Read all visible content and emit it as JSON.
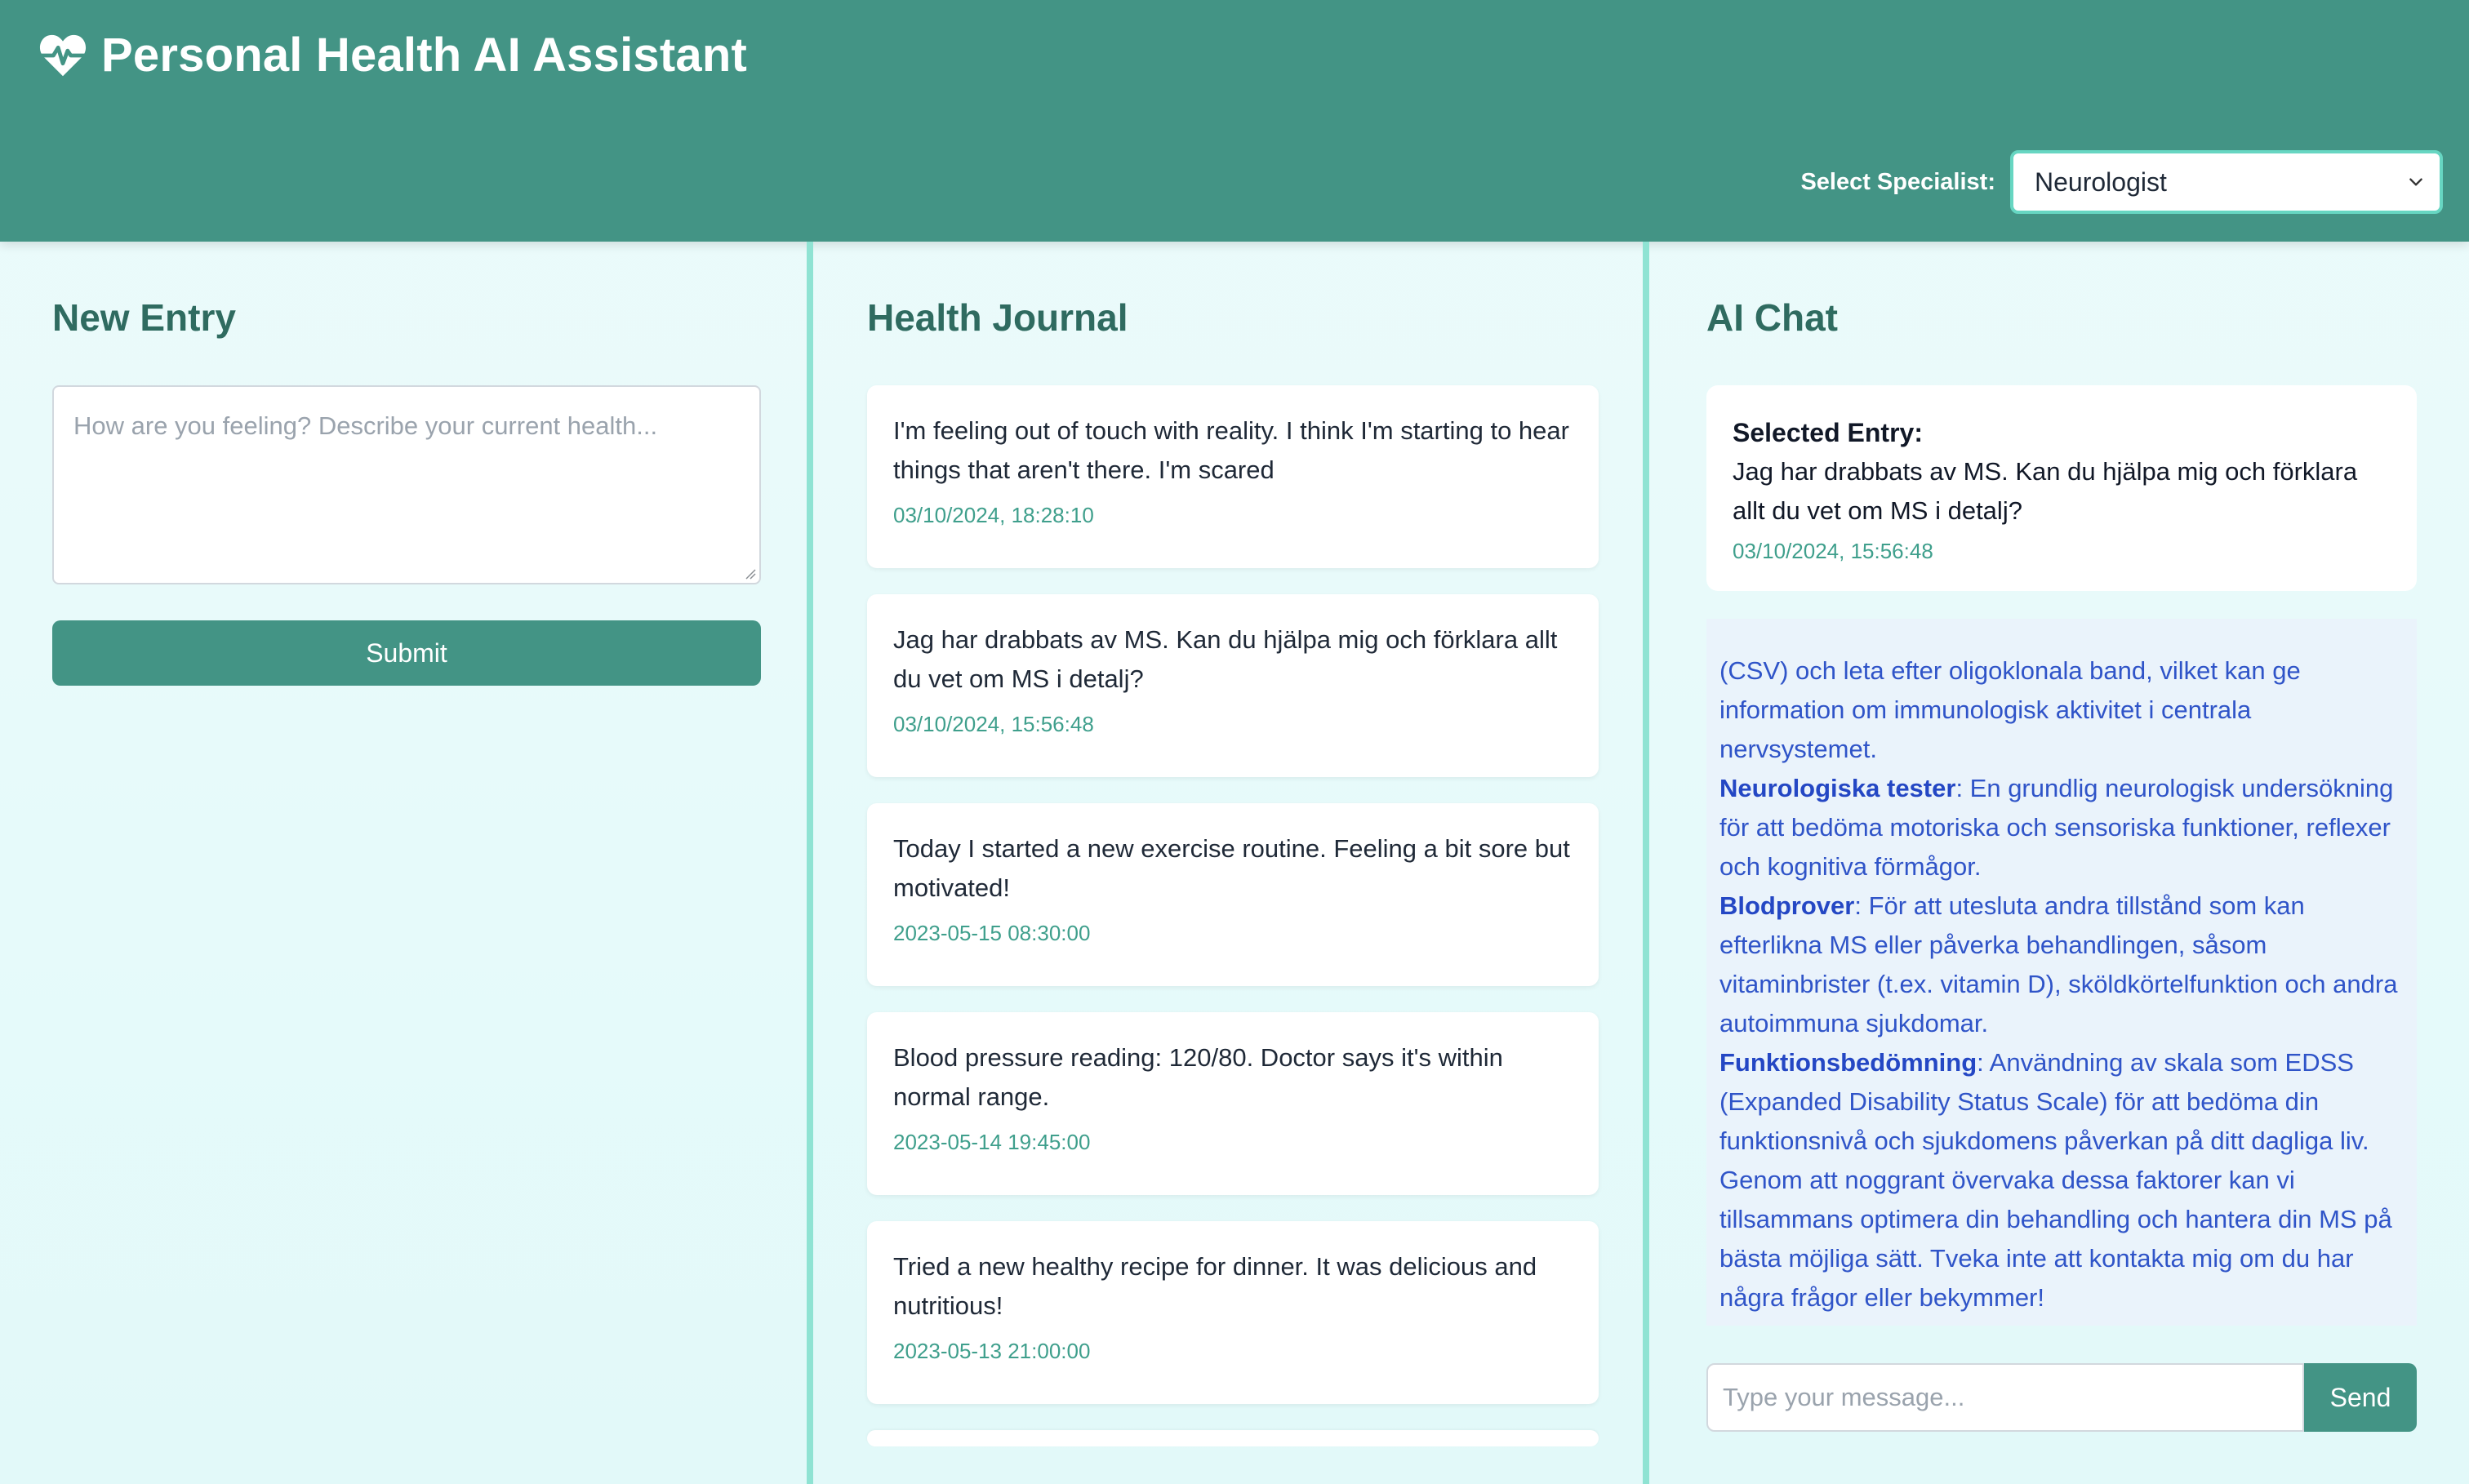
{
  "header": {
    "title": "Personal Health AI Assistant",
    "icon": "heart-pulse-icon",
    "specialist_label": "Select Specialist:",
    "specialist_selected": "Neurologist"
  },
  "new_entry": {
    "title": "New Entry",
    "placeholder": "How are you feeling? Describe your current health...",
    "submit_label": "Submit"
  },
  "journal": {
    "title": "Health Journal",
    "entries": [
      {
        "text": "I'm feeling out of touch with reality. I think I'm starting to hear things that aren't there. I'm scared",
        "date": "03/10/2024, 18:28:10"
      },
      {
        "text": "Jag har drabbats av MS. Kan du hjälpa mig och förklara allt du vet om MS i detalj?",
        "date": "03/10/2024, 15:56:48"
      },
      {
        "text": "Today I started a new exercise routine. Feeling a bit sore but motivated!",
        "date": "2023-05-15 08:30:00"
      },
      {
        "text": "Blood pressure reading: 120/80. Doctor says it's within normal range.",
        "date": "2023-05-14 19:45:00"
      },
      {
        "text": "Tried a new healthy recipe for dinner. It was delicious and nutritious!",
        "date": "2023-05-13 21:00:00"
      }
    ]
  },
  "chat": {
    "title": "AI Chat",
    "selected_label": "Selected Entry:",
    "selected_text": "Jag har drabbats av MS. Kan du hjälpa mig och förklara allt du vet om MS i detalj?",
    "selected_date": "03/10/2024, 15:56:48",
    "messages": {
      "line0": "(CSV) och leta efter oligoklonala band, vilket kan ge information om immunologisk aktivitet i centrala nervsystemet.",
      "neuro_bold": "Neurologiska tester",
      "neuro_text": ": En grundlig neurologisk undersökning för att bedöma motoriska och sensoriska funktioner, reflexer och kognitiva förmågor.",
      "blood_bold": "Blodprover",
      "blood_text": ": För att utesluta andra tillstånd som kan efterlikna MS eller påverka behandlingen, såsom vitaminbrister (t.ex. vitamin D), sköldkörtelfunktion och andra autoimmuna sjukdomar.",
      "func_bold": "Funktionsbedömning",
      "func_text": ": Användning av skala som EDSS (Expanded Disability Status Scale) för att bedöma din funktionsnivå och sjukdomens påverkan på ditt dagliga liv.",
      "closing": "Genom att noggrant övervaka dessa faktorer kan vi tillsammans optimera din behandling och hantera din MS på bästa möjliga sätt. Tveka inte att kontakta mig om du har några frågor eller bekymmer!"
    },
    "input_placeholder": "Type your message...",
    "send_label": "Send"
  },
  "colors": {
    "header": "#439485",
    "accent_border": "#8fe3d3",
    "date_text": "#3f9f8c",
    "chat_text": "#2f54c8",
    "chat_bg": "#eaf3fb"
  }
}
